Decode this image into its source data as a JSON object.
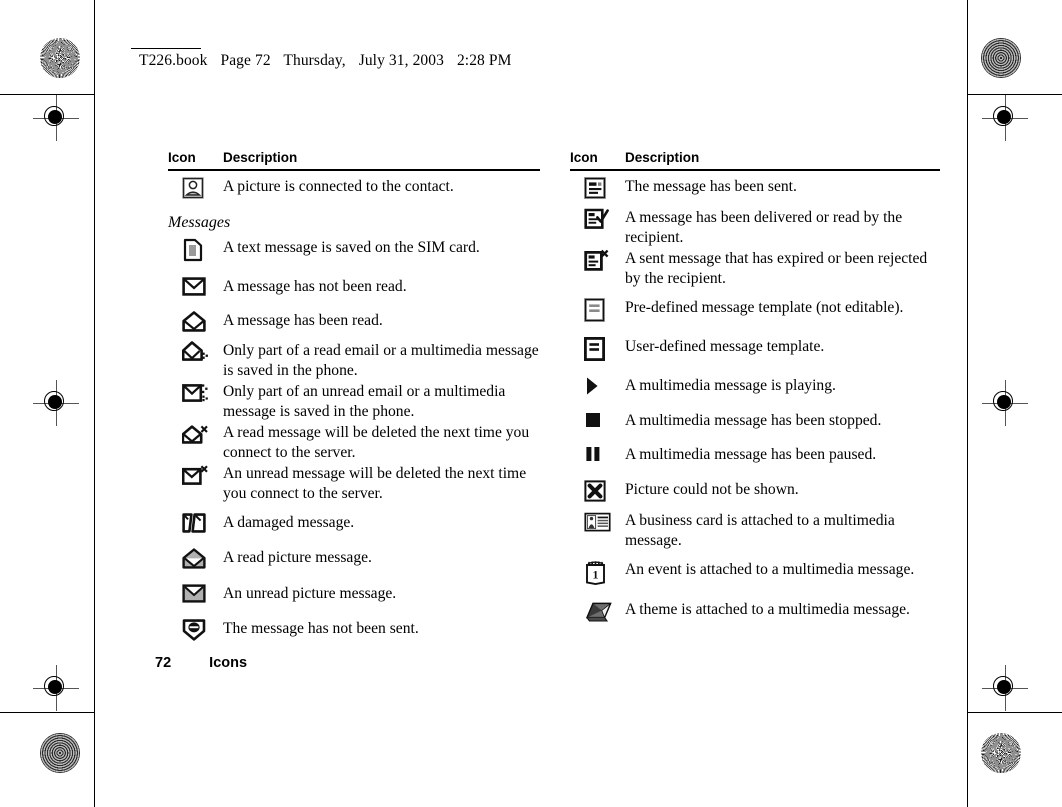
{
  "document": {
    "header": {
      "filename": "T226.book",
      "page_label": "Page 72",
      "weekday": "Thursday,",
      "date": "July 31, 2003",
      "time": "2:28 PM"
    },
    "footer": {
      "page_number": "72",
      "chapter": "Icons"
    }
  },
  "columns": {
    "left": {
      "header": {
        "icon": "Icon",
        "description": "Description"
      },
      "section_title": "Messages",
      "rows": [
        {
          "icon": "contact-picture-icon",
          "text": "A picture is connected to the contact."
        },
        {
          "icon": "sim-card-icon",
          "text": "A text message is saved on the SIM card."
        },
        {
          "icon": "closed-envelope-icon",
          "text": "A message has not been read."
        },
        {
          "icon": "open-envelope-icon",
          "text": "A message has been read."
        },
        {
          "icon": "open-envelope-partial-icon",
          "text": "Only part of a read email or a multimedia message is saved in the phone."
        },
        {
          "icon": "closed-envelope-partial-icon",
          "text": "Only part of an unread email or a multimedia message is saved in the phone."
        },
        {
          "icon": "open-envelope-delete-icon",
          "text": "A read message will be deleted the next time you connect to the server."
        },
        {
          "icon": "closed-envelope-delete-icon",
          "text": "An unread message will be deleted the next time you connect to the server."
        },
        {
          "icon": "damaged-message-icon",
          "text": "A damaged message."
        },
        {
          "icon": "read-picture-message-icon",
          "text": "A read picture message."
        },
        {
          "icon": "unread-picture-message-icon",
          "text": "An unread picture message."
        },
        {
          "icon": "message-not-sent-icon",
          "text": "The message has not been sent."
        }
      ]
    },
    "right": {
      "header": {
        "icon": "Icon",
        "description": "Description"
      },
      "rows": [
        {
          "icon": "message-sent-icon",
          "text": "The message has been sent."
        },
        {
          "icon": "message-delivered-icon",
          "text": "A message has been delivered or read by the recipient."
        },
        {
          "icon": "message-expired-icon",
          "text": "A sent message that has expired or been rejected by the recipient."
        },
        {
          "icon": "predefined-template-icon",
          "text": "Pre-defined message template (not editable)."
        },
        {
          "icon": "user-template-icon",
          "text": "User-defined message template."
        },
        {
          "icon": "play-icon",
          "text": "A multimedia message is playing."
        },
        {
          "icon": "stop-icon",
          "text": "A multimedia message has been stopped."
        },
        {
          "icon": "pause-icon",
          "text": "A multimedia message has been paused."
        },
        {
          "icon": "picture-error-icon",
          "text": "Picture could not be shown."
        },
        {
          "icon": "business-card-icon",
          "text": "A business card is attached to a multimedia message."
        },
        {
          "icon": "event-calendar-icon",
          "text": "An event is attached to a multimedia message."
        },
        {
          "icon": "theme-icon",
          "text": "A theme is attached to a multimedia message."
        }
      ]
    }
  },
  "colors": {
    "ink": "#000000",
    "paper": "#ffffff",
    "icon_gray": "#9a9a9a",
    "icon_dark": "#1a1a1a"
  }
}
